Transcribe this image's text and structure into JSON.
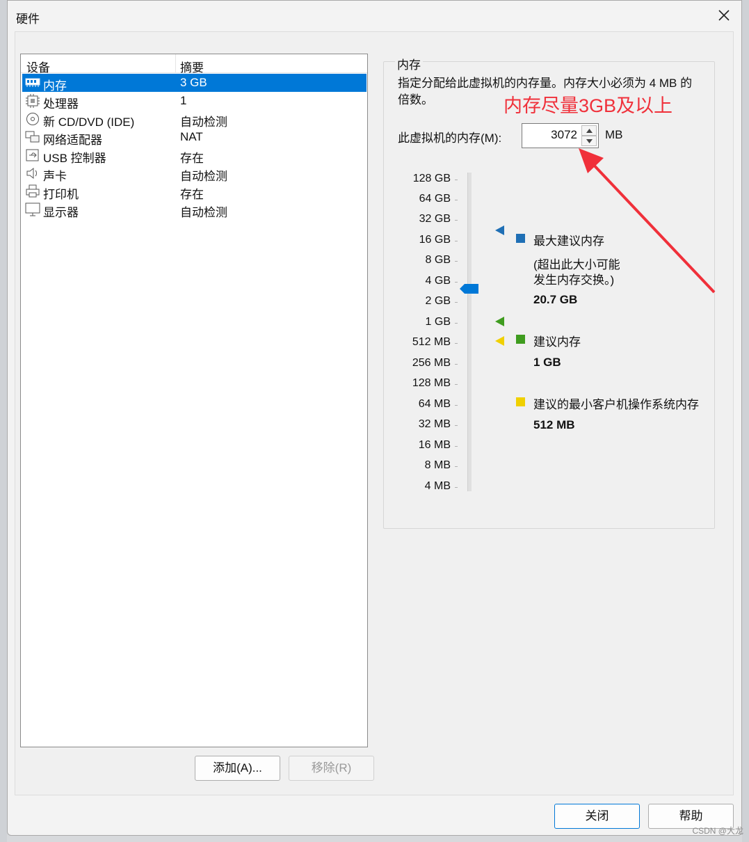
{
  "window": {
    "title": "硬件"
  },
  "device_list": {
    "headers": {
      "device": "设备",
      "summary": "摘要"
    },
    "items": [
      {
        "name": "内存",
        "summary": "3 GB",
        "icon": "memory-icon",
        "selected": true
      },
      {
        "name": "处理器",
        "summary": "1",
        "icon": "cpu-icon"
      },
      {
        "name": "新 CD/DVD (IDE)",
        "summary": "自动检测",
        "icon": "cd-icon"
      },
      {
        "name": "网络适配器",
        "summary": "NAT",
        "icon": "network-icon"
      },
      {
        "name": "USB 控制器",
        "summary": "存在",
        "icon": "usb-icon"
      },
      {
        "name": "声卡",
        "summary": "自动检测",
        "icon": "speaker-icon"
      },
      {
        "name": "打印机",
        "summary": "存在",
        "icon": "printer-icon"
      },
      {
        "name": "显示器",
        "summary": "自动检测",
        "icon": "monitor-icon"
      }
    ]
  },
  "buttons": {
    "add": "添加(A)...",
    "remove": "移除(R)",
    "close": "关闭",
    "help": "帮助"
  },
  "memory": {
    "group_title": "内存",
    "description": "指定分配给此虚拟机的内存量。内存大小必须为 4 MB 的倍数。",
    "annotation": "内存尽量3GB及以上",
    "field_label": "此虚拟机的内存(M):",
    "value": "3072",
    "unit": "MB",
    "scale": [
      "128 GB",
      "64 GB",
      "32 GB",
      "16 GB",
      "8 GB",
      "4 GB",
      "2 GB",
      "1 GB",
      "512 MB",
      "256 MB",
      "128 MB",
      "64 MB",
      "32 MB",
      "16 MB",
      "8 MB",
      "4 MB"
    ],
    "legend": {
      "max": {
        "label": "最大建议内存",
        "note_line1": "(超出此大小可能",
        "note_line2": "发生内存交换。)",
        "value": "20.7 GB",
        "color": "#1f6fb5"
      },
      "recommended": {
        "label": "建议内存",
        "value": "1 GB",
        "color": "#3f9c1f"
      },
      "minimum": {
        "label": "建议的最小客户机操作系统内存",
        "value": "512 MB",
        "color": "#f0d000"
      }
    },
    "accent_color": "#0078d7",
    "annotation_color": "#f0303a"
  },
  "watermark": "CSDN @大龙"
}
